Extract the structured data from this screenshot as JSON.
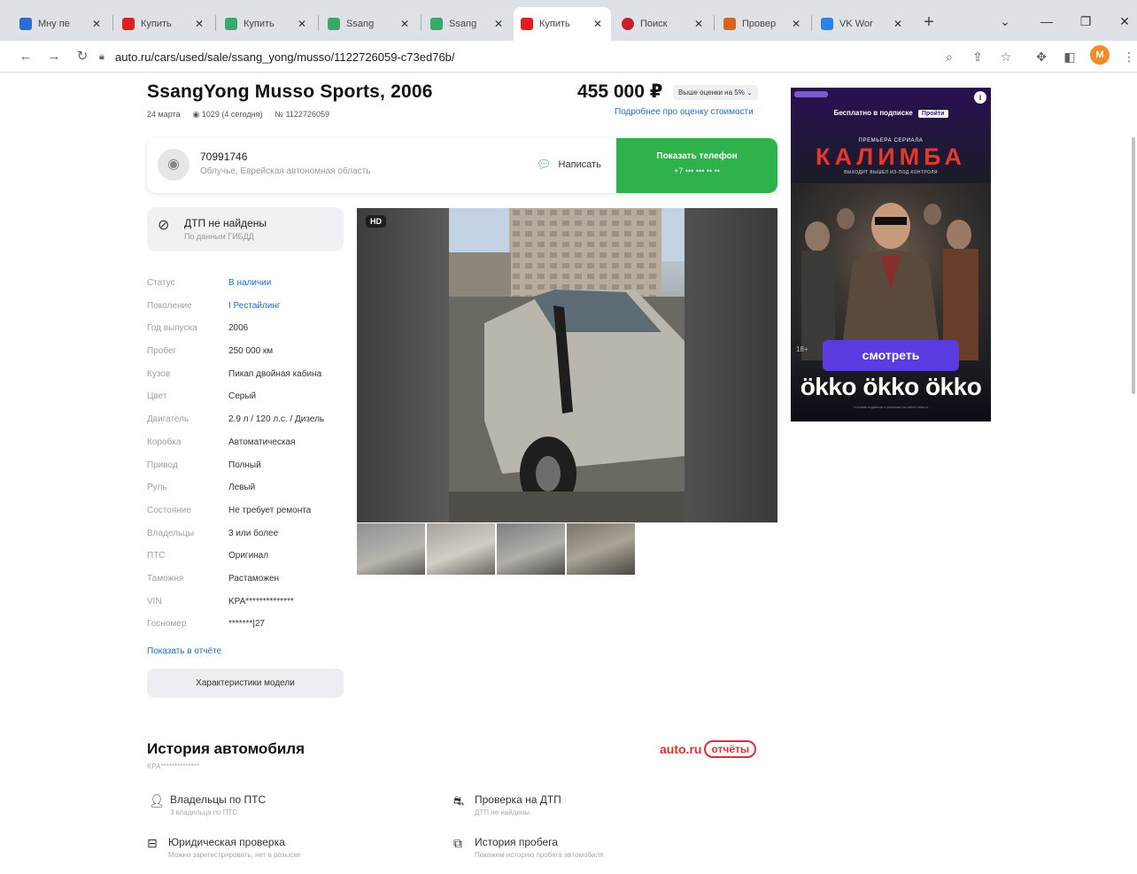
{
  "browser": {
    "tabs": [
      {
        "label": "Мну пе",
        "color": "#2b6cd3",
        "active": false
      },
      {
        "label": "Купить",
        "color": "#e02020",
        "active": false
      },
      {
        "label": "Купить",
        "color": "#3aa86b",
        "active": false
      },
      {
        "label": "Ssang",
        "color": "#3aa86b",
        "active": false
      },
      {
        "label": "Ssang",
        "color": "#3aa86b",
        "active": false
      },
      {
        "label": "Купить",
        "color": "#e02020",
        "active": true
      },
      {
        "label": "Поиск",
        "color": "#c8202d",
        "active": false
      },
      {
        "label": "Провер",
        "color": "#d8631a",
        "active": false
      },
      {
        "label": "VK Wor",
        "color": "#2a83e8",
        "active": false
      }
    ],
    "url": "auto.ru/cars/used/sale/ssang_yong/musso/1122726059-c73ed76b/",
    "profile_initial": "M"
  },
  "listing": {
    "title": "SsangYong Musso Sports, 2006",
    "date": "24 марта",
    "views": "◉ 1029 (4 сегодня)",
    "listing_no": "№ 1122726059",
    "price": "455 000 ₽",
    "price_badge": "Выше оценки на 5% ⌄",
    "price_link": "Подробнее про оценку стоимости"
  },
  "seller": {
    "name": "70991746",
    "location": "Облучье, Еврейская автономная область",
    "write_label": "Написать",
    "phone_button": "Показать телефон",
    "phone_masked": "+7 ••• ••• •• ••"
  },
  "dtp": {
    "title": "ДТП не найдены",
    "subtitle": "По данным ГИБДД"
  },
  "specs": [
    {
      "key": "Статус",
      "value": "В наличии",
      "link": true
    },
    {
      "key": "Поколение",
      "value": "I Рестайлинг",
      "link": true
    },
    {
      "key": "Год выпуска",
      "value": "2006",
      "link": false
    },
    {
      "key": "Пробег",
      "value": "250 000 км",
      "link": false
    },
    {
      "key": "Кузов",
      "value": "Пикап двойная кабина",
      "link": false
    },
    {
      "key": "Цвет",
      "value": "Серый",
      "link": false
    },
    {
      "key": "Двигатель",
      "value": "2.9 л / 120 л.с. / Дизель",
      "link": false
    },
    {
      "key": "Коробка",
      "value": "Автоматическая",
      "link": false
    },
    {
      "key": "Привод",
      "value": "Полный",
      "link": false
    },
    {
      "key": "Руль",
      "value": "Левый",
      "link": false
    },
    {
      "key": "Состояние",
      "value": "Не требует ремонта",
      "link": false
    },
    {
      "key": "Владельцы",
      "value": "3 или более",
      "link": false
    },
    {
      "key": "ПТС",
      "value": "Оригинал",
      "link": false
    },
    {
      "key": "Таможня",
      "value": "Растаможен",
      "link": false
    },
    {
      "key": "VIN",
      "value": "KPA**************",
      "link": false
    },
    {
      "key": "Госномер",
      "value": "*******|27",
      "link": false
    }
  ],
  "show_report": "Показать в отчёте",
  "char_button": "Характеристики модели",
  "gallery": {
    "hd": "HD",
    "thumb_colors": [
      "#8f9194",
      "#a6a29a",
      "#7b7e80",
      "#7a7569"
    ]
  },
  "ad": {
    "subscription": "Бесплатно в подписке",
    "sub_button": "Пройти",
    "premiere": "ПРЕМЬЕРА СЕРИАЛА",
    "film": "КАЛИМБА",
    "tagline": "ВЫХОДИТ ВЫШЕЛ ИЗ-ПОД КОНТРОЛЯ",
    "age": "18+",
    "watch": "смотреть",
    "brand": "ökko ökko ökko",
    "fine_print": "Условия подписки и реклама на сайте okko.tv"
  },
  "history": {
    "title": "История автомобиля",
    "vin": "KPA**************",
    "brand": "auto.ru",
    "brand_pill": "отчёты",
    "items": [
      {
        "title": "Владельцы по ПТС",
        "subtitle": "3 владельца по ПТС",
        "icon": "person-icon"
      },
      {
        "title": "Проверка на ДТП",
        "subtitle": "ДТП не найдены",
        "icon": "car-crash-icon"
      },
      {
        "title": "Юридическая проверка",
        "subtitle": "Можно зарегистрировать, нет в розыске",
        "icon": "briefcase-icon"
      },
      {
        "title": "История пробега",
        "subtitle": "Покажем историю пробега автомобиля",
        "icon": "odometer-icon"
      }
    ]
  }
}
